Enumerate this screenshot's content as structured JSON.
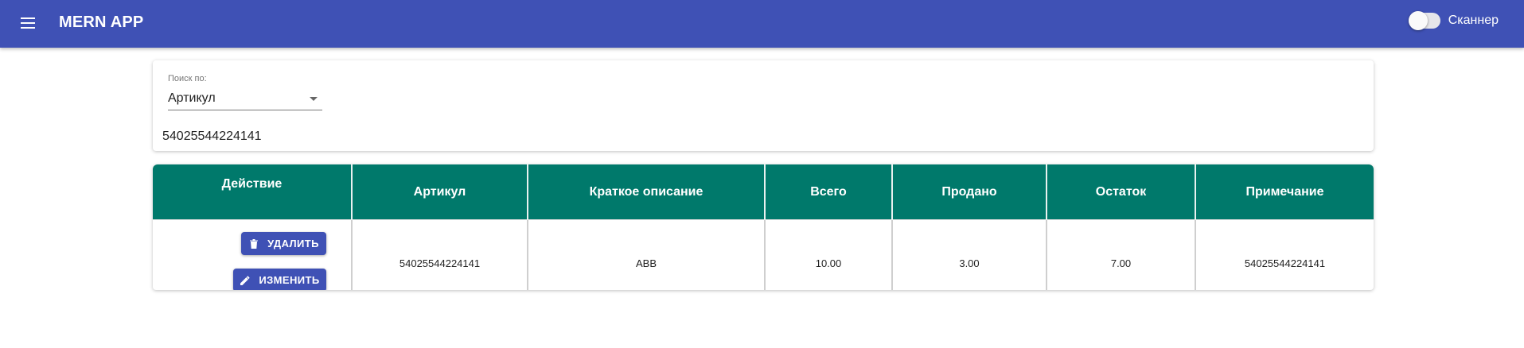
{
  "appbar": {
    "title": "MERN APP",
    "menu_icon": "menu-icon",
    "scanner_label": "Сканнер"
  },
  "search": {
    "label": "Поиск по:",
    "selected": "Артикул",
    "value": "54025544224141"
  },
  "table": {
    "headers": [
      "Действие",
      "Артикул",
      "Краткое описание",
      "Всего",
      "Продано",
      "Остаток",
      "Примечание"
    ],
    "rows": [
      {
        "article": "54025544224141",
        "description": "ABB",
        "total": "10.00",
        "sold": "3.00",
        "remaining": "7.00",
        "note": "54025544224141",
        "delete_label": "УДАЛИТЬ",
        "edit_label": "ИЗМЕНИТЬ"
      }
    ]
  },
  "colors": {
    "primary": "#3f51b5",
    "table_header": "#00796b"
  }
}
